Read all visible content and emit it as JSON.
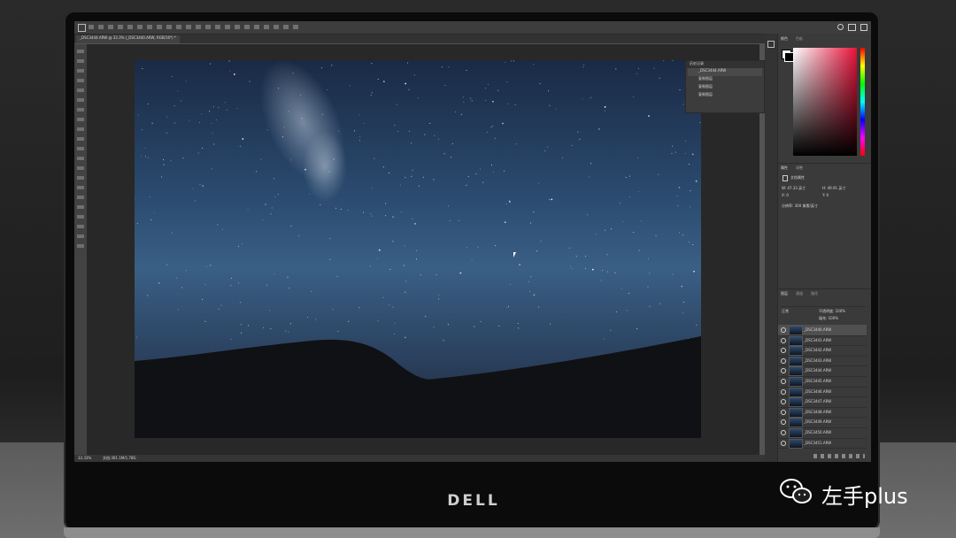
{
  "device": {
    "brand": "DELL"
  },
  "watermark": {
    "text": "左手plus"
  },
  "photoshop": {
    "document_tab": "_DSC3444.ARW @ 33.3% (_DSC3440.ARW, RGB/16*) *",
    "zoom": "33.33%",
    "doc_info": "文档:301.1M/1.78G",
    "history_panel": {
      "title": "历史记录",
      "snapshot": "_DSC3444.ARW",
      "steps": [
        "复制图层",
        "复制图层",
        "复制图层"
      ]
    },
    "color_panel": {
      "tabs": [
        "颜色",
        "色板"
      ]
    },
    "properties_panel": {
      "tabs": [
        "属性",
        "调整"
      ],
      "type": "文档属性",
      "w": "W: 47.33 英寸",
      "h": "H: 49.91 英寸",
      "x": "X: 0",
      "y": "Y: 0",
      "resolution": "分辨率: 300 像素/英寸"
    },
    "layers_panel": {
      "tabs": [
        "图层",
        "通道",
        "路径"
      ],
      "blend_mode": "正常",
      "opacity": "不透明度: 100%",
      "fill": "填充: 100%",
      "layers": [
        "_DSC3440.ARW",
        "_DSC3441.ARW",
        "_DSC3442.ARW",
        "_DSC3443.ARW",
        "_DSC3444.ARW",
        "_DSC3445.ARW",
        "_DSC3446.ARW",
        "_DSC3447.ARW",
        "_DSC3448.ARW",
        "_DSC3449.ARW",
        "_DSC3450.ARW",
        "_DSC3451.ARW"
      ]
    }
  }
}
